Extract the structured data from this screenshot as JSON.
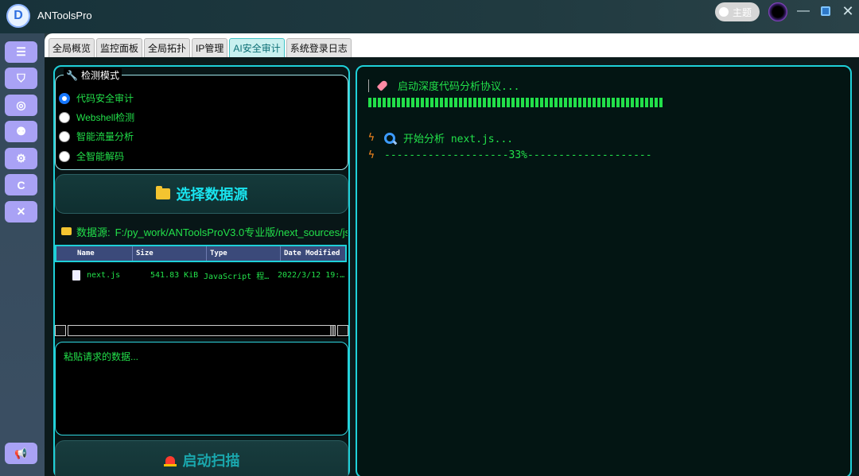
{
  "app": {
    "title": "ANToolsPro",
    "logo_letter": "D",
    "theme_label": "主题"
  },
  "window_controls": {
    "minimize": "—",
    "close": "✕"
  },
  "sidebar": {
    "items": [
      {
        "icon": "list-icon",
        "glyph": "☰"
      },
      {
        "icon": "shield-icon",
        "glyph": "⛉"
      },
      {
        "icon": "user-circle-icon",
        "glyph": "◎"
      },
      {
        "icon": "users-icon",
        "glyph": "⚉"
      },
      {
        "icon": "gear-icon",
        "glyph": "⚙"
      },
      {
        "icon": "c-letter-icon",
        "glyph": "C"
      },
      {
        "icon": "tools-icon",
        "glyph": "✕"
      }
    ],
    "bottom_items": [
      {
        "icon": "megaphone-icon",
        "glyph": "📢"
      }
    ]
  },
  "tabs": [
    {
      "label": "全局概览",
      "active": false
    },
    {
      "label": "监控面板",
      "active": false
    },
    {
      "label": "全局拓扑",
      "active": false
    },
    {
      "label": "IP管理",
      "active": false
    },
    {
      "label": "AI安全审计",
      "active": true
    },
    {
      "label": "系统登录日志",
      "active": false
    }
  ],
  "detect_mode": {
    "legend": "检测模式",
    "legend_icon": "wrench-icon",
    "options": [
      {
        "label": "代码安全审计",
        "checked": true
      },
      {
        "label": "Webshell检测",
        "checked": false
      },
      {
        "label": "智能流量分析",
        "checked": false
      },
      {
        "label": "全智能解码",
        "checked": false
      }
    ]
  },
  "select_source_button": "选择数据源",
  "datasource": {
    "label": "数据源:",
    "path": "F:/py_work/ANToolsProV3.0专业版/next_sources/js"
  },
  "file_table": {
    "columns": [
      "Name",
      "Size",
      "Type",
      "Date Modified"
    ],
    "rows": [
      {
        "name": "next.js",
        "size": "541.83 KiB",
        "type": "JavaScript 程…",
        "modified": "2022/3/12 19:…"
      }
    ]
  },
  "paste_placeholder": "粘贴请求的数据...",
  "start_scan_button": "启动扫描",
  "terminal": {
    "line1": "启动深度代码分析协议...",
    "line2": "开始分析 next.js...",
    "progress_text": "--------------------33%--------------------",
    "progress_percent": 33
  },
  "colors": {
    "accent_cyan": "#1fd0d8",
    "terminal_green": "#22e04a",
    "sidebar_button": "#a9a2f5"
  }
}
